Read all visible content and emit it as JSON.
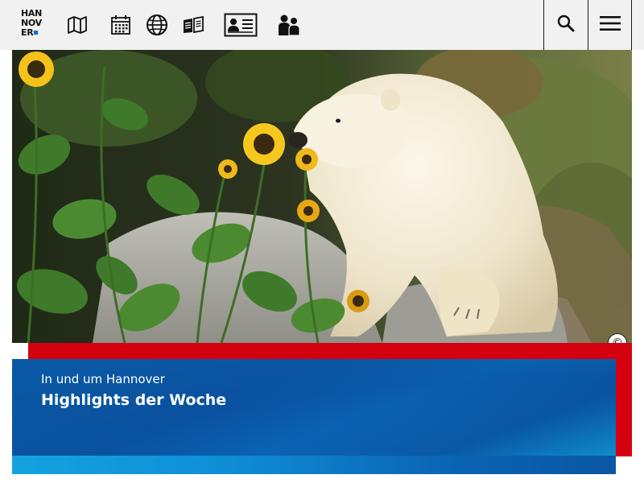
{
  "header": {
    "logo_lines": [
      "HAN",
      "NOV",
      "ER"
    ],
    "nav_icons": [
      {
        "name": "map-icon"
      },
      {
        "name": "calendar-icon"
      },
      {
        "name": "globe-icon"
      },
      {
        "name": "open-book-icon"
      },
      {
        "name": "id-card-icon"
      },
      {
        "name": "people-icon"
      }
    ],
    "search_icon": "search-icon",
    "menu_icon": "hamburger-menu-icon"
  },
  "hero": {
    "subject": "polar-bear-with-sunflowers",
    "copyright_symbol": "©"
  },
  "teaser": {
    "kicker": "In und um Hannover",
    "headline": "Highlights der Woche"
  },
  "colors": {
    "header_bg": "#f1f1f1",
    "accent_red": "#d4000f",
    "teaser_blue": "#0a5aa5",
    "teaser_light_blue": "#14a3df",
    "logo_blue": "#0b6fd6"
  }
}
